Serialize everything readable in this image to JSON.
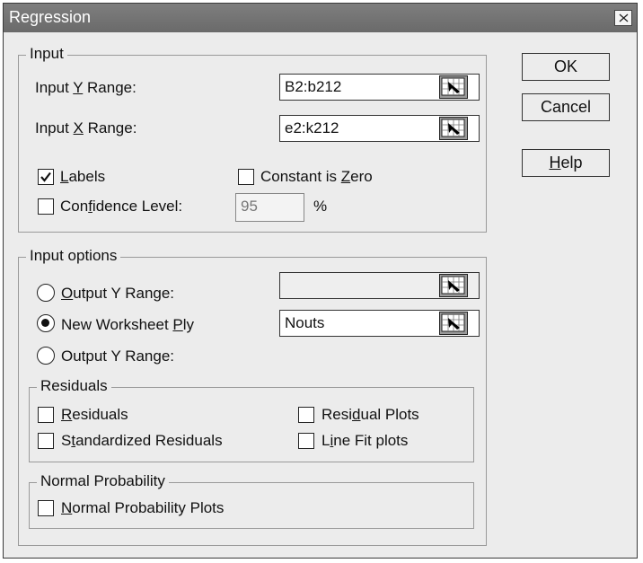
{
  "window": {
    "title": "Regression"
  },
  "buttons": {
    "ok": "OK",
    "cancel": "Cancel",
    "help_pre": "",
    "help_u": "H",
    "help_post": "elp"
  },
  "input": {
    "legend": "Input",
    "y_range": {
      "pre": "Input ",
      "u": "Y",
      "post": " Range:",
      "value": "B2:b212"
    },
    "x_range": {
      "pre": "Input ",
      "u": "X",
      "post": " Range:",
      "value": "e2:k212"
    },
    "labels": {
      "pre": "",
      "u": "L",
      "post": "abels",
      "checked": true
    },
    "constant_zero": {
      "pre": "Constant is ",
      "u": "Z",
      "post": "ero",
      "checked": false
    },
    "confidence": {
      "pre": "Con",
      "u": "f",
      "post": "idence Level:",
      "value": "95",
      "unit": "%",
      "checked": false
    }
  },
  "input_options": {
    "legend": "Input options",
    "output_range": {
      "pre": "",
      "u": "O",
      "post": "utput Y Range:",
      "value": "",
      "selected": false
    },
    "new_ply": {
      "pre": "New Worksheet ",
      "u": "P",
      "post": "ly",
      "value": "Nouts",
      "selected": true
    },
    "output_range2": {
      "label": "Output Y Range:",
      "selected": false
    }
  },
  "residuals": {
    "legend": "Residuals",
    "residuals": {
      "pre": "",
      "u": "R",
      "post": "esiduals",
      "checked": false
    },
    "standardized": {
      "pre": "S",
      "u": "t",
      "post": "andardized Residuals",
      "checked": false
    },
    "residual_plots": {
      "pre": "Resi",
      "u": "d",
      "post": "ual Plots",
      "checked": false
    },
    "line_fit": {
      "pre": "L",
      "u": "i",
      "post": "ne Fit plots",
      "checked": false
    }
  },
  "normal_probability": {
    "legend": "Normal Probability",
    "plots": {
      "pre": "",
      "u": "N",
      "post": "ormal Probability Plots",
      "checked": false
    }
  }
}
